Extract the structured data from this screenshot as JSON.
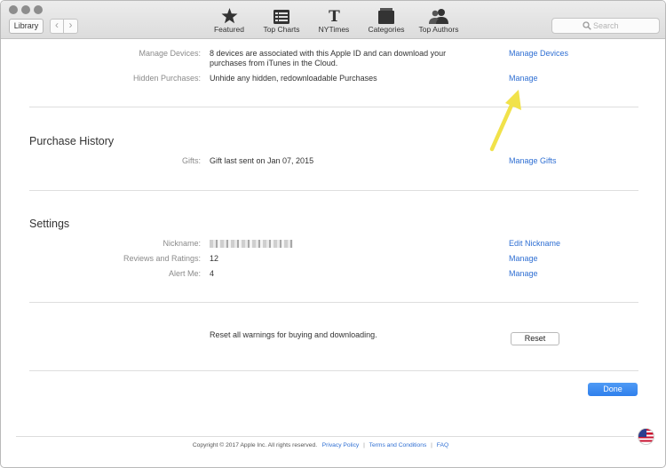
{
  "toolbar": {
    "library_label": "Library",
    "back_glyph": "‹",
    "forward_glyph": "›",
    "tabs": [
      {
        "label": "Featured",
        "icon": "star-icon"
      },
      {
        "label": "Top Charts",
        "icon": "list-icon"
      },
      {
        "label": "NYTimes",
        "icon": "nytimes-icon"
      },
      {
        "label": "Categories",
        "icon": "books-icon"
      },
      {
        "label": "Top Authors",
        "icon": "people-icon"
      }
    ],
    "search_placeholder": "Search"
  },
  "account": {
    "manage_devices": {
      "label": "Manage Devices:",
      "value": "8 devices are associated with this Apple ID and can download your purchases from iTunes in the Cloud.",
      "action": "Manage Devices"
    },
    "hidden_purchases": {
      "label": "Hidden Purchases:",
      "value": "Unhide any hidden, redownloadable Purchases",
      "action": "Manage"
    }
  },
  "purchase_history": {
    "title": "Purchase History",
    "gifts": {
      "label": "Gifts:",
      "value": "Gift last sent on Jan 07, 2015",
      "action": "Manage Gifts"
    }
  },
  "settings": {
    "title": "Settings",
    "nickname": {
      "label": "Nickname:",
      "action": "Edit Nickname"
    },
    "reviews": {
      "label": "Reviews and Ratings:",
      "value": "12",
      "action": "Manage"
    },
    "alert_me": {
      "label": "Alert Me:",
      "value": "4",
      "action": "Manage"
    }
  },
  "reset": {
    "text": "Reset all warnings for buying and downloading.",
    "button": "Reset"
  },
  "done_label": "Done",
  "footer": {
    "copyright": "Copyright © 2017 Apple Inc. All rights reserved.",
    "privacy": "Privacy Policy",
    "terms": "Terms and Conditions",
    "faq": "FAQ",
    "separator": "|"
  },
  "colors": {
    "link": "#2f6fd3",
    "done_button": "#2f7fec",
    "annotation_arrow": "#f1e24a"
  }
}
